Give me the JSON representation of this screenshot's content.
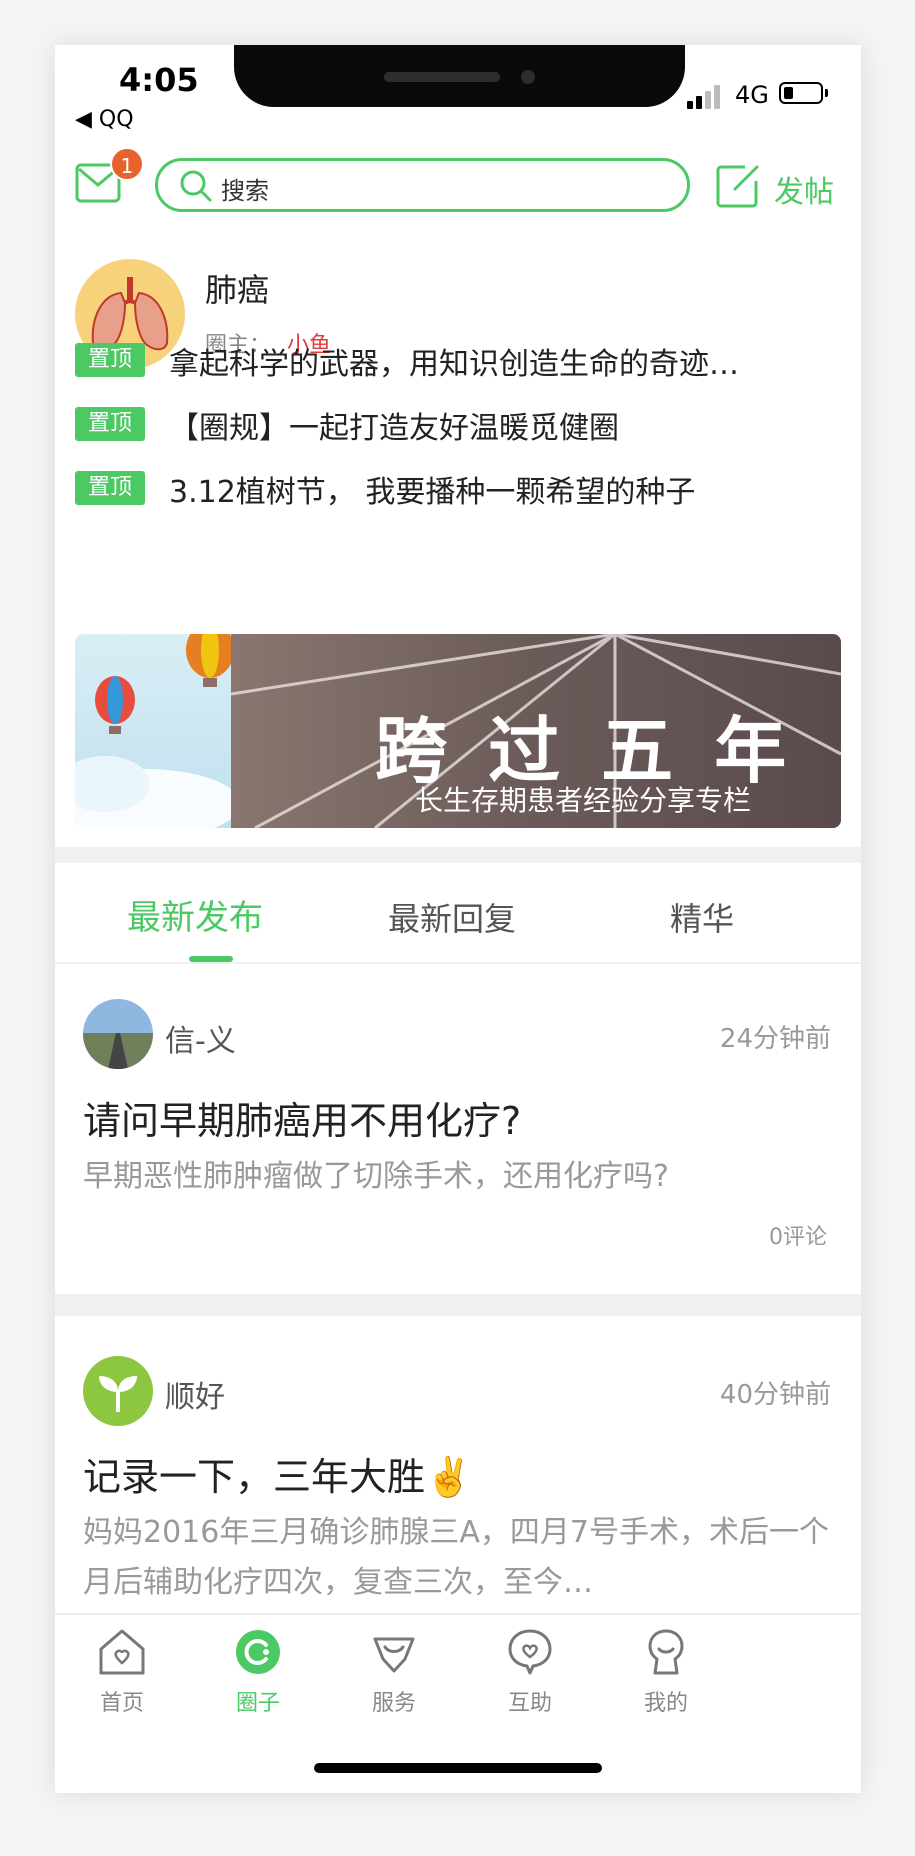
{
  "status_bar": {
    "time": "4:05",
    "back_app": "◀ QQ",
    "network": "4G"
  },
  "header": {
    "mail_badge": "1",
    "search_placeholder": "搜索",
    "post_label": "发帖"
  },
  "circle": {
    "name": "肺癌",
    "owner_label": "圈主：",
    "owner_name": "小鱼"
  },
  "pinned": [
    {
      "tag": "置顶",
      "title": "拿起科学的武器，用知识创造生命的奇迹…"
    },
    {
      "tag": "置顶",
      "title": "【圈规】一起打造友好温暖觅健圈"
    },
    {
      "tag": "置顶",
      "title": "3.12植树节， 我要播种一颗希望的种子"
    }
  ],
  "banner": {
    "headline": "跨 过 五 年",
    "subline": "长生存期患者经验分享专栏"
  },
  "tabs": [
    {
      "label": "最新发布",
      "active": true
    },
    {
      "label": "最新回复",
      "active": false
    },
    {
      "label": "精华",
      "active": false
    }
  ],
  "posts": [
    {
      "author": "信-义",
      "time": "24分钟前",
      "title": "请问早期肺癌用不用化疗?",
      "body": "早期恶性肺肿瘤做了切除手术，还用化疗吗?",
      "comments": "0评论"
    },
    {
      "author": "顺好",
      "time": "40分钟前",
      "title": "记录一下，三年大胜✌️",
      "body": "妈妈2016年三月确诊肺腺三A，四月7号手术，术后一个月后辅助化疗四次，复查三次，至今…"
    }
  ],
  "nav": [
    {
      "label": "首页",
      "icon": "home-icon",
      "active": false
    },
    {
      "label": "圈子",
      "icon": "circle-icon",
      "active": true
    },
    {
      "label": "服务",
      "icon": "service-icon",
      "active": false
    },
    {
      "label": "互助",
      "icon": "help-icon",
      "active": false
    },
    {
      "label": "我的",
      "icon": "profile-icon",
      "active": false
    }
  ],
  "colors": {
    "accent": "#4cc865",
    "badge": "#e8622e",
    "owner": "#e03c3c"
  }
}
